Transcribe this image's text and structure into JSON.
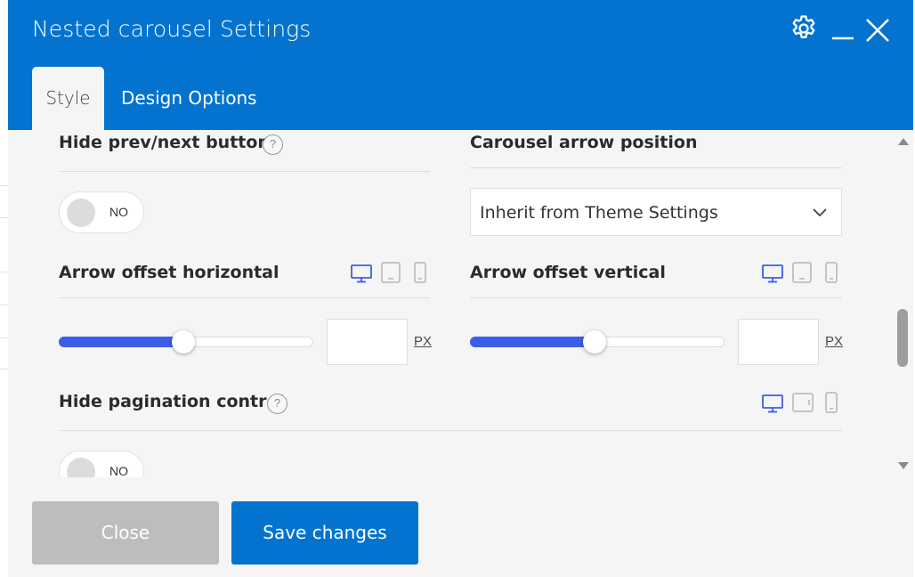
{
  "window": {
    "title": "Nested carousel Settings",
    "icons": {
      "settings": "gear-icon",
      "minimize": "minimize-icon",
      "close": "close-icon"
    }
  },
  "tabs": [
    {
      "label": "Style",
      "active": true
    },
    {
      "label": "Design Options",
      "active": false
    }
  ],
  "fields": {
    "hide_prev_next": {
      "label": "Hide prev/next buttons",
      "help": "?",
      "toggle": "NO"
    },
    "arrow_position": {
      "label": "Carousel arrow position",
      "selected": "Inherit from Theme Settings"
    },
    "arrow_offset_h": {
      "label": "Arrow offset horizontal",
      "unit": "PX",
      "value": "",
      "slider_percent": 49
    },
    "arrow_offset_v": {
      "label": "Arrow offset vertical",
      "unit": "PX",
      "value": "",
      "slider_percent": 49
    },
    "hide_pagination": {
      "label": "Hide pagination control",
      "help": "?",
      "toggle": "NO"
    }
  },
  "device_icons": [
    "desktop-icon",
    "tablet-icon",
    "mobile-icon"
  ],
  "footer": {
    "close_label": "Close",
    "save_label": "Save changes"
  },
  "colors": {
    "header": "#0473d0",
    "slider_fill": "#3b5de8",
    "device_active": "#3b5de8",
    "close_button": "#bdbdbd",
    "save_button": "#0473d0"
  }
}
